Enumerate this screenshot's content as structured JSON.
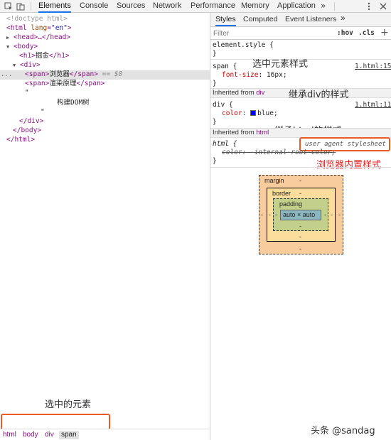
{
  "toolbar": {
    "tabs": [
      "Elements",
      "Console",
      "Sources",
      "Network",
      "Performance",
      "Memory",
      "Application"
    ],
    "active_tab": "Elements",
    "more": "»"
  },
  "dom_tree": {
    "doctype": "<!doctype html>",
    "html_open": "<html",
    "html_attr": "lang",
    "html_val": "\"en\"",
    "html_close": ">",
    "head": "<head>…</head>",
    "body_open": "<body>",
    "h1_open": "<h1>",
    "h1_text": "掘金",
    "h1_close": "</h1>",
    "div_open": "<div>",
    "span1_open": "<span>",
    "span1_text": "浏览器",
    "span1_close": "</span>",
    "span1_eq": "== $0",
    "span2_open": "<span>",
    "span2_text": "渲染原理",
    "span2_close": "</span>",
    "quote1": "\"",
    "text_node": "构建DOM树",
    "quote2": "\"",
    "div_close": "</div>",
    "body_close": "</body>",
    "html_end": "</html>",
    "dots": "..."
  },
  "breadcrumb": [
    "html",
    "body",
    "div",
    "span"
  ],
  "styles_tabs": [
    "Styles",
    "Computed",
    "Event Listeners"
  ],
  "styles_more": "»",
  "filter": {
    "placeholder": "Filter",
    "hov": ":hov",
    "cls": ".cls",
    "plus": "+"
  },
  "rules": {
    "element_style": "element.style {",
    "element_style_close": "}",
    "span_selector": "span {",
    "span_source": "1.html:15",
    "span_prop": "font-size",
    "span_value": "16px;",
    "span_close": "}",
    "inherited_div_label": "Inherited from",
    "inherited_div_tag": "div",
    "div_selector": "div {",
    "div_source": "1.html:11",
    "div_prop": "color",
    "div_value": "blue;",
    "div_close": "}",
    "inherited_html_label": "Inherited from",
    "inherited_html_tag": "html",
    "html_selector": "html {",
    "html_source": "user agent stylesheet",
    "html_prop_struck": "color: -internal-root-color;",
    "html_close": "}"
  },
  "annotations": {
    "selected_style": "选中元素样式",
    "inherit_div": "继承div的样式",
    "inherit_html": "继承html的样式",
    "browser_builtin": "浏览器内置样式",
    "selected_element": "选中的元素"
  },
  "box_model": {
    "margin_label": "margin",
    "margin_top": "-",
    "margin_bottom": "-",
    "margin_left": "-",
    "margin_right": "-",
    "border_label": "border",
    "border_top": "-",
    "border_bottom": "-",
    "border_left": "-",
    "border_right": "-",
    "padding_label": "padding",
    "padding_bottom": "-",
    "padding_left": "-",
    "padding_right": "-",
    "content": "auto × auto"
  },
  "watermark": "头条 @sandag",
  "colors": {
    "accent": "#1a73e8",
    "annotation_red": "#e02020",
    "highlight_border": "#ee5a24",
    "color_swatch": "#0000ff"
  }
}
